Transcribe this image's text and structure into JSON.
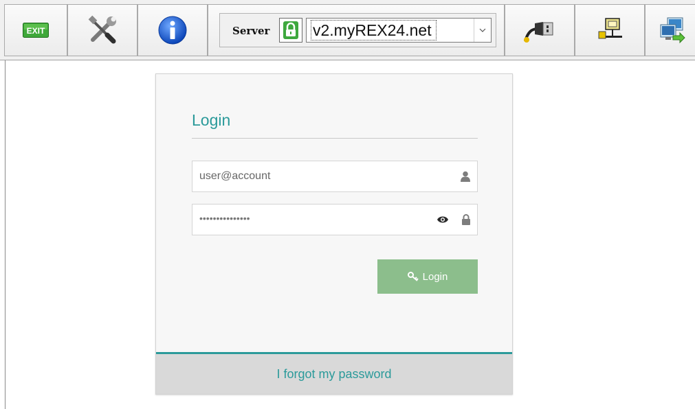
{
  "toolbar": {
    "buttons": [
      {
        "id": "exit",
        "label": "EXIT",
        "icon": "exit-icon"
      },
      {
        "id": "tools",
        "icon": "tools-icon"
      },
      {
        "id": "info",
        "icon": "info-icon"
      },
      {
        "id": "usb",
        "icon": "usb-plug-icon"
      },
      {
        "id": "network",
        "icon": "network-icon"
      },
      {
        "id": "remote",
        "icon": "remote-desktop-icon"
      }
    ],
    "server": {
      "label": "Server",
      "lock_icon": "lock-icon",
      "value": "v2.myREX24.net"
    }
  },
  "login": {
    "title": "Login",
    "username_placeholder": "user@account",
    "password_mask": "•••••••••••••••",
    "button_label": "Login",
    "forgot_link": "I forgot my password"
  },
  "colors": {
    "accent": "#2b9a9a",
    "button": "#8cbe8c",
    "footer": "#d9d9d9",
    "exit_green": "#4caf2a",
    "lock_green": "#3ea83e"
  }
}
